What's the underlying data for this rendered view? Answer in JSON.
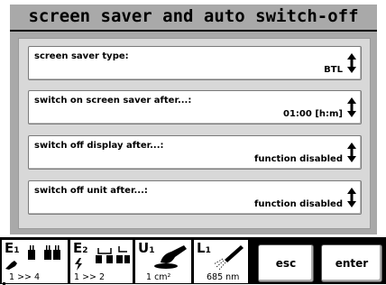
{
  "title": "screen saver and auto switch-off",
  "settings": [
    {
      "label": "screen saver type:",
      "value": "BTL"
    },
    {
      "label": "switch on screen saver after...:",
      "value": "01:00 [h:m]"
    },
    {
      "label": "switch off display after...:",
      "value": "function disabled"
    },
    {
      "label": "switch off unit after...:",
      "value": "function disabled"
    }
  ],
  "channels": {
    "e1": {
      "letter": "E",
      "sub": "1",
      "info": "1 >> 4"
    },
    "e2": {
      "letter": "E",
      "sub": "2",
      "info": "1 >> 2"
    },
    "u1": {
      "letter": "U",
      "sub": "1",
      "info": "1 cm²"
    },
    "l1": {
      "letter": "L",
      "sub": "1",
      "info": "685 nm"
    }
  },
  "buttons": {
    "esc": "esc",
    "enter": "enter"
  },
  "colors": {
    "screen_bg": "#a9a9a9",
    "panel_bg": "#d8d8d8",
    "footer_bg": "#000000"
  }
}
